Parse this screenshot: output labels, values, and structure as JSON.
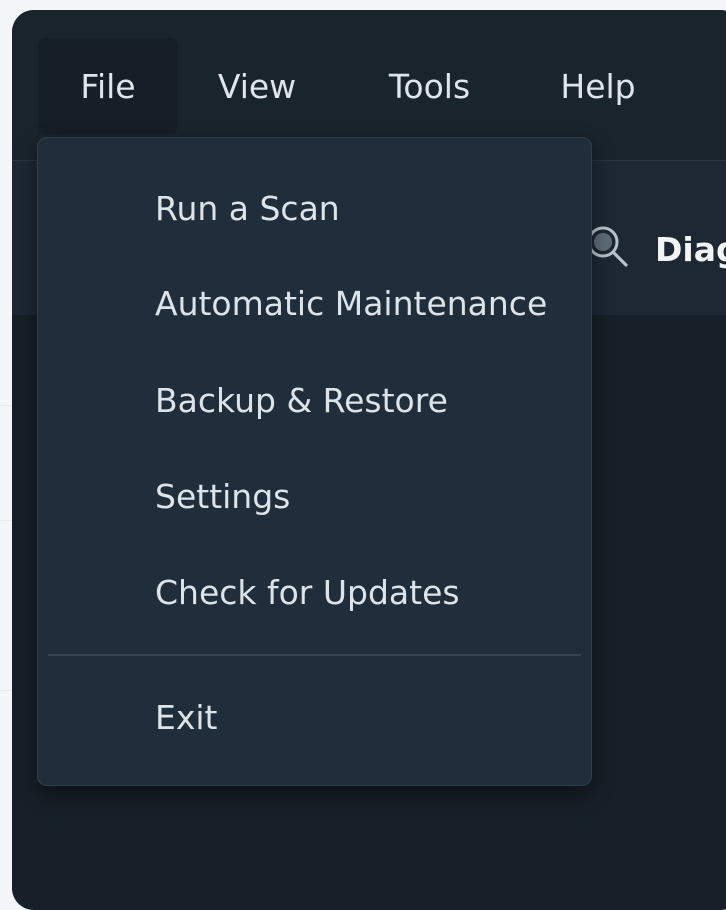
{
  "menubar": {
    "items": [
      {
        "label": "File",
        "active": true
      },
      {
        "label": "View",
        "active": false
      },
      {
        "label": "Tools",
        "active": false
      },
      {
        "label": "Help",
        "active": false
      }
    ]
  },
  "toolbar": {
    "label": "Diag",
    "icon": "search-icon"
  },
  "file_menu": {
    "items": [
      {
        "label": "Run a Scan"
      },
      {
        "label": "Automatic Maintenance"
      },
      {
        "label": "Backup & Restore"
      },
      {
        "label": "Settings"
      },
      {
        "label": "Check for Updates"
      }
    ],
    "exit_label": "Exit"
  },
  "colors": {
    "window_bg": "#182129",
    "menu_bg": "#202e3b",
    "text": "#dce3e9",
    "separator": "#34434f"
  }
}
